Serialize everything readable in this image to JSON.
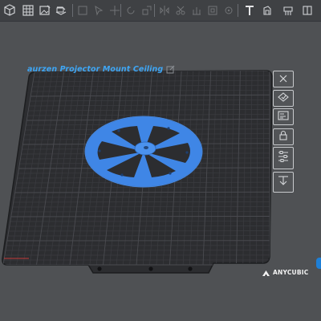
{
  "toolbar": {
    "icons": [
      "cube-icon",
      "grid-select-icon",
      "image-edit-icon",
      "layers-icon",
      "box-icon",
      "cursor-icon",
      "move-icon",
      "rotate-icon",
      "scale-icon",
      "mirror-icon",
      "cut-icon",
      "text-icon",
      "support-icon",
      "hollow-icon",
      "drill-icon",
      "paint-icon"
    ]
  },
  "plate": {
    "title": "aurzen Projector Mount Ceiling",
    "brand": "ANYCUBIC"
  },
  "side_toolbar": {
    "buttons": [
      "close-x-icon",
      "auto-arrange-icon",
      "plate-settings-icon",
      "lock-icon",
      "slider-settings-icon",
      "arrange-icon"
    ]
  },
  "colors": {
    "background": "#4f5154",
    "toolbar": "#3f4144",
    "plate": "#2c2d30",
    "grid": "#3b3c40",
    "model": "#3f86e6",
    "accent": "#3ea6f5"
  }
}
